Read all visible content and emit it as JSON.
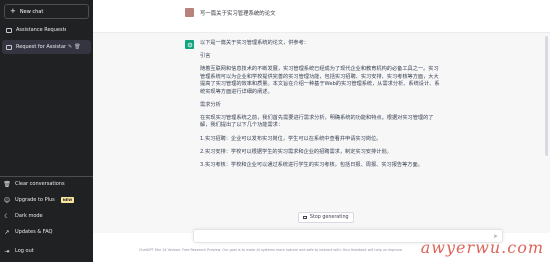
{
  "sidebar": {
    "new_chat_label": "New chat",
    "conversations": [
      {
        "label": "Assistance Requested."
      },
      {
        "label": "Request for Assistan"
      }
    ],
    "bottom": [
      {
        "label": "Clear conversations",
        "icon": "trash-icon"
      },
      {
        "label": "Upgrade to Plus",
        "icon": "user-icon",
        "badge": "NEW"
      },
      {
        "label": "Dark mode",
        "icon": "moon-icon"
      },
      {
        "label": "Updates & FAQ",
        "icon": "external-link-icon"
      },
      {
        "label": "Log out",
        "icon": "logout-icon"
      }
    ]
  },
  "chat": {
    "user_message": "写一篇关于实习管理系统的论文",
    "bot_paragraphs": [
      "以下是一篇关于实习管理系统的论文，供参考：",
      "引言",
      "随着互联网和信息技术的不断发展，实习管理系统已经成为了现代企业和教育机构的必备工具之一。实习管理系统可以为企业和学校提供完善的实习管理功能，包括实习招聘、实习安排、实习考核等方面，大大提高了实习管理的效率和质量。本文旨在介绍一种基于Web的实习管理系统，从需求分析、系统设计、系统实现等方面进行详细的阐述。",
      "需求分析",
      "在实现实习管理系统之前，我们首先需要进行需求分析，明确系统的功能和特点。根据对实习管理的了解，我们提出了以下几个功能需求：",
      "1.实习招聘：企业可以发布实习岗位，学生可以在系统中查看并申请实习岗位。",
      "2.实习安排：学校可以根据学生的实习需求和企业的招聘需求，制定实习安排计划。",
      "3.实习考核：学校和企业可以通过系统进行学生的实习考核，包括日报、周报、实习报告等方面。"
    ],
    "stop_label": "Stop generating",
    "footer_link": "ChatGPT Mar 14 Version",
    "footer_text": ". Free Research Preview. Our goal is to make AI systems more natural and safe to interact with. Your feedback will help us improve."
  },
  "watermark": "awyerwu.com",
  "colors": {
    "sidebar_bg": "#202123",
    "bot_avatar": "#10a37f",
    "badge": "#fae69e"
  }
}
